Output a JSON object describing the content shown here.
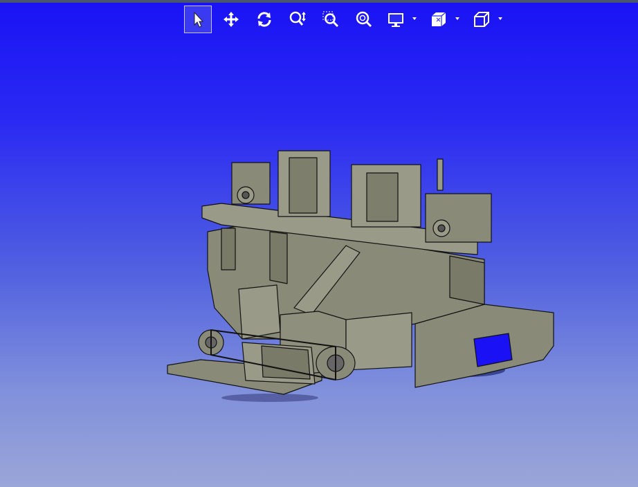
{
  "toolbar": {
    "tools": [
      {
        "name": "select-tool",
        "icon": "cursor-arrow-icon",
        "active": true
      },
      {
        "name": "pan-tool",
        "icon": "move-arrows-icon",
        "active": false
      },
      {
        "name": "rotate-tool",
        "icon": "rotate-icon",
        "active": false
      },
      {
        "name": "zoom-tool",
        "icon": "zoom-updown-icon",
        "active": false
      },
      {
        "name": "zoom-window-tool",
        "icon": "zoom-window-icon",
        "active": false
      },
      {
        "name": "zoom-fit-tool",
        "icon": "zoom-fit-icon",
        "active": false
      },
      {
        "name": "display-mode-dropdown",
        "icon": "monitor-icon",
        "active": false
      },
      {
        "name": "section-dropdown",
        "icon": "section-cut-icon",
        "active": false
      },
      {
        "name": "view-orientation-dropdown",
        "icon": "cube-icon",
        "active": false
      }
    ]
  },
  "colors": {
    "background_top": "#1a12f5",
    "background_bottom": "#9aa6d8",
    "model_fill": "#8a8a78",
    "model_edge": "#1a1a1a"
  }
}
